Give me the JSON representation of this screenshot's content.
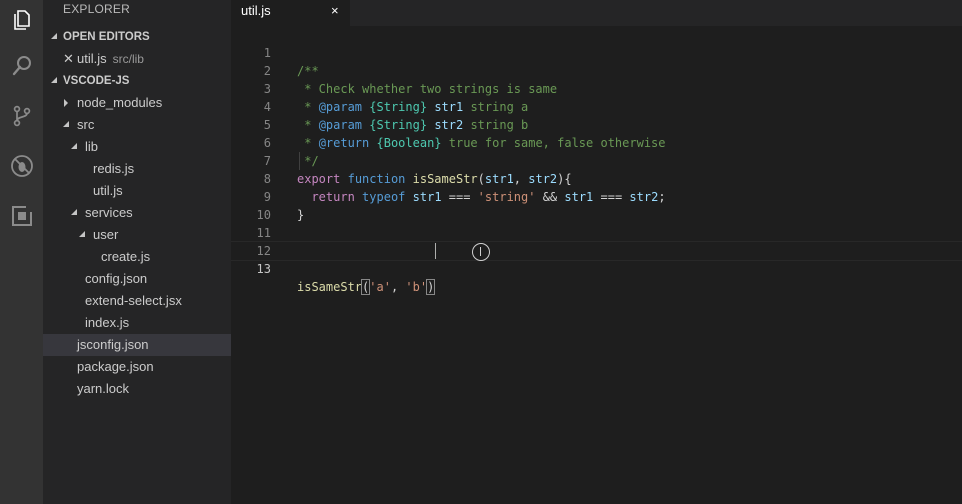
{
  "activity_bar": {
    "icons": [
      "files-icon",
      "search-icon",
      "source-control-icon",
      "debug-icon",
      "extensions-icon"
    ]
  },
  "sidebar": {
    "title": "EXPLORER",
    "open_editors": {
      "header": "OPEN EDITORS",
      "items": [
        {
          "name": "util.js",
          "path": "src/lib"
        }
      ]
    },
    "folder": {
      "header": "VSCODE-JS",
      "tree": [
        {
          "label": "node_modules",
          "type": "folder",
          "expanded": false
        },
        {
          "label": "src",
          "type": "folder",
          "expanded": true
        },
        {
          "label": "lib",
          "type": "folder",
          "expanded": true
        },
        {
          "label": "redis.js",
          "type": "file"
        },
        {
          "label": "util.js",
          "type": "file"
        },
        {
          "label": "services",
          "type": "folder",
          "expanded": true
        },
        {
          "label": "user",
          "type": "folder",
          "expanded": true
        },
        {
          "label": "create.js",
          "type": "file"
        },
        {
          "label": "config.json",
          "type": "file"
        },
        {
          "label": "extend-select.jsx",
          "type": "file"
        },
        {
          "label": "index.js",
          "type": "file"
        },
        {
          "label": "jsconfig.json",
          "type": "file",
          "selected": true
        },
        {
          "label": "package.json",
          "type": "file"
        },
        {
          "label": "yarn.lock",
          "type": "file"
        }
      ]
    }
  },
  "editor": {
    "tab": {
      "label": "util.js",
      "close": "×"
    },
    "line_numbers": [
      "1",
      "2",
      "3",
      "4",
      "5",
      "6",
      "7",
      "8",
      "9",
      "10",
      "11",
      "12",
      "13"
    ],
    "active_line": "13",
    "code": {
      "l1": "/**",
      "l2": " * Check whether two strings is same",
      "l3": {
        "star": " * ",
        "tag": "@param",
        "type": "{String}",
        "name": "str1",
        "desc": " string a"
      },
      "l4": {
        "star": " * ",
        "tag": "@param",
        "type": "{String}",
        "name": "str2",
        "desc": " string b"
      },
      "l5": {
        "star": " * ",
        "tag": "@return",
        "type": "{Boolean}",
        "desc": " true for same, false otherwise"
      },
      "l6": " */",
      "l7": {
        "kw": "export",
        "kw2": "function",
        "fn": "isSameStr",
        "open": "(",
        "p1": "str1",
        "comma": ", ",
        "p2": "str2",
        "close": "){"
      },
      "l8": {
        "indent": "  ",
        "kw": "return",
        "kw2": "typeof",
        "v1": "str1",
        "op1": " === ",
        "str": "'string'",
        "op2": " && ",
        "v2": "str1",
        "op3": " === ",
        "v3": "str2",
        "end": ";"
      },
      "l9": "}",
      "l13": {
        "fn": "isSameStr",
        "open": "(",
        "a": "'a'",
        "comma": ", ",
        "b": "'b'",
        "close": ")"
      }
    }
  },
  "colors": {
    "activity_bar": "#333333",
    "sidebar": "#252526",
    "editor": "#1e1e1e",
    "selected_row": "#37373d"
  }
}
